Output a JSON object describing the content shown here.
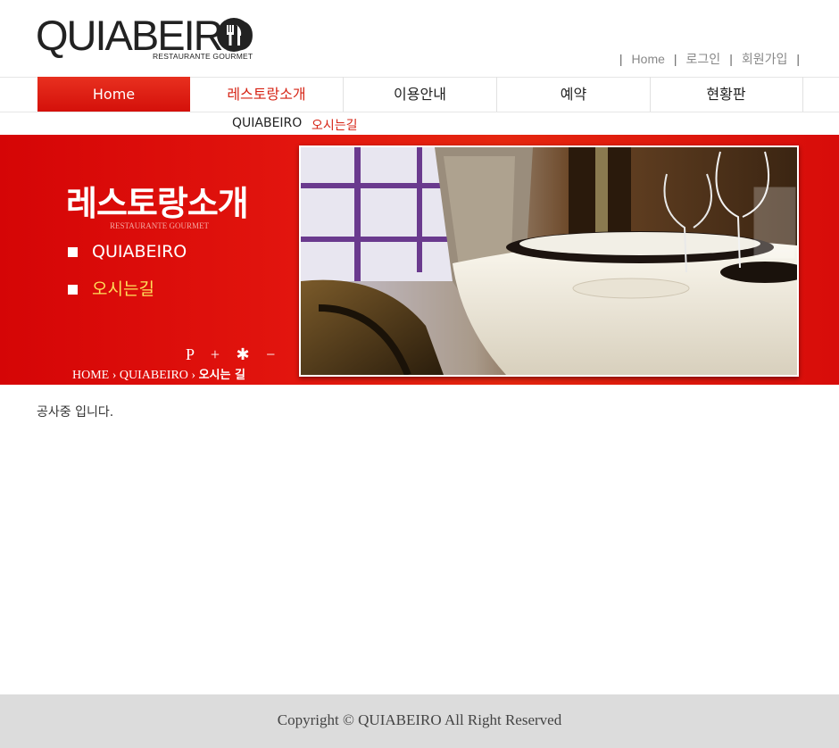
{
  "brand": {
    "name": "QUIABEIRO",
    "tagline": "RESTAURANTE GOURMET"
  },
  "utility_links": [
    "Home",
    "로그인",
    "회원가입"
  ],
  "nav": {
    "items": [
      "Home",
      "레스토랑소개",
      "이용안내",
      "예약",
      "현황판"
    ]
  },
  "subnav": {
    "items": [
      "QUIABEIRO",
      "오시는길"
    ]
  },
  "banner": {
    "title": "레스토랑소개",
    "subtitle": "RESTAURANTE GOURMET",
    "menu": [
      "QUIABEIRO",
      "오시는길"
    ],
    "font_controls": "P + ✱ −",
    "breadcrumb": [
      "HOME",
      "QUIABEIRO",
      "오시는 길"
    ]
  },
  "content": {
    "message": "공사중 입니다."
  },
  "footer": {
    "copyright": "Copyright © QUIABEIRO All Right Reserved"
  },
  "colors": {
    "brand_red": "#d50506",
    "highlight_yellow": "#ffe05a",
    "active_nav_text": "#d62314"
  }
}
